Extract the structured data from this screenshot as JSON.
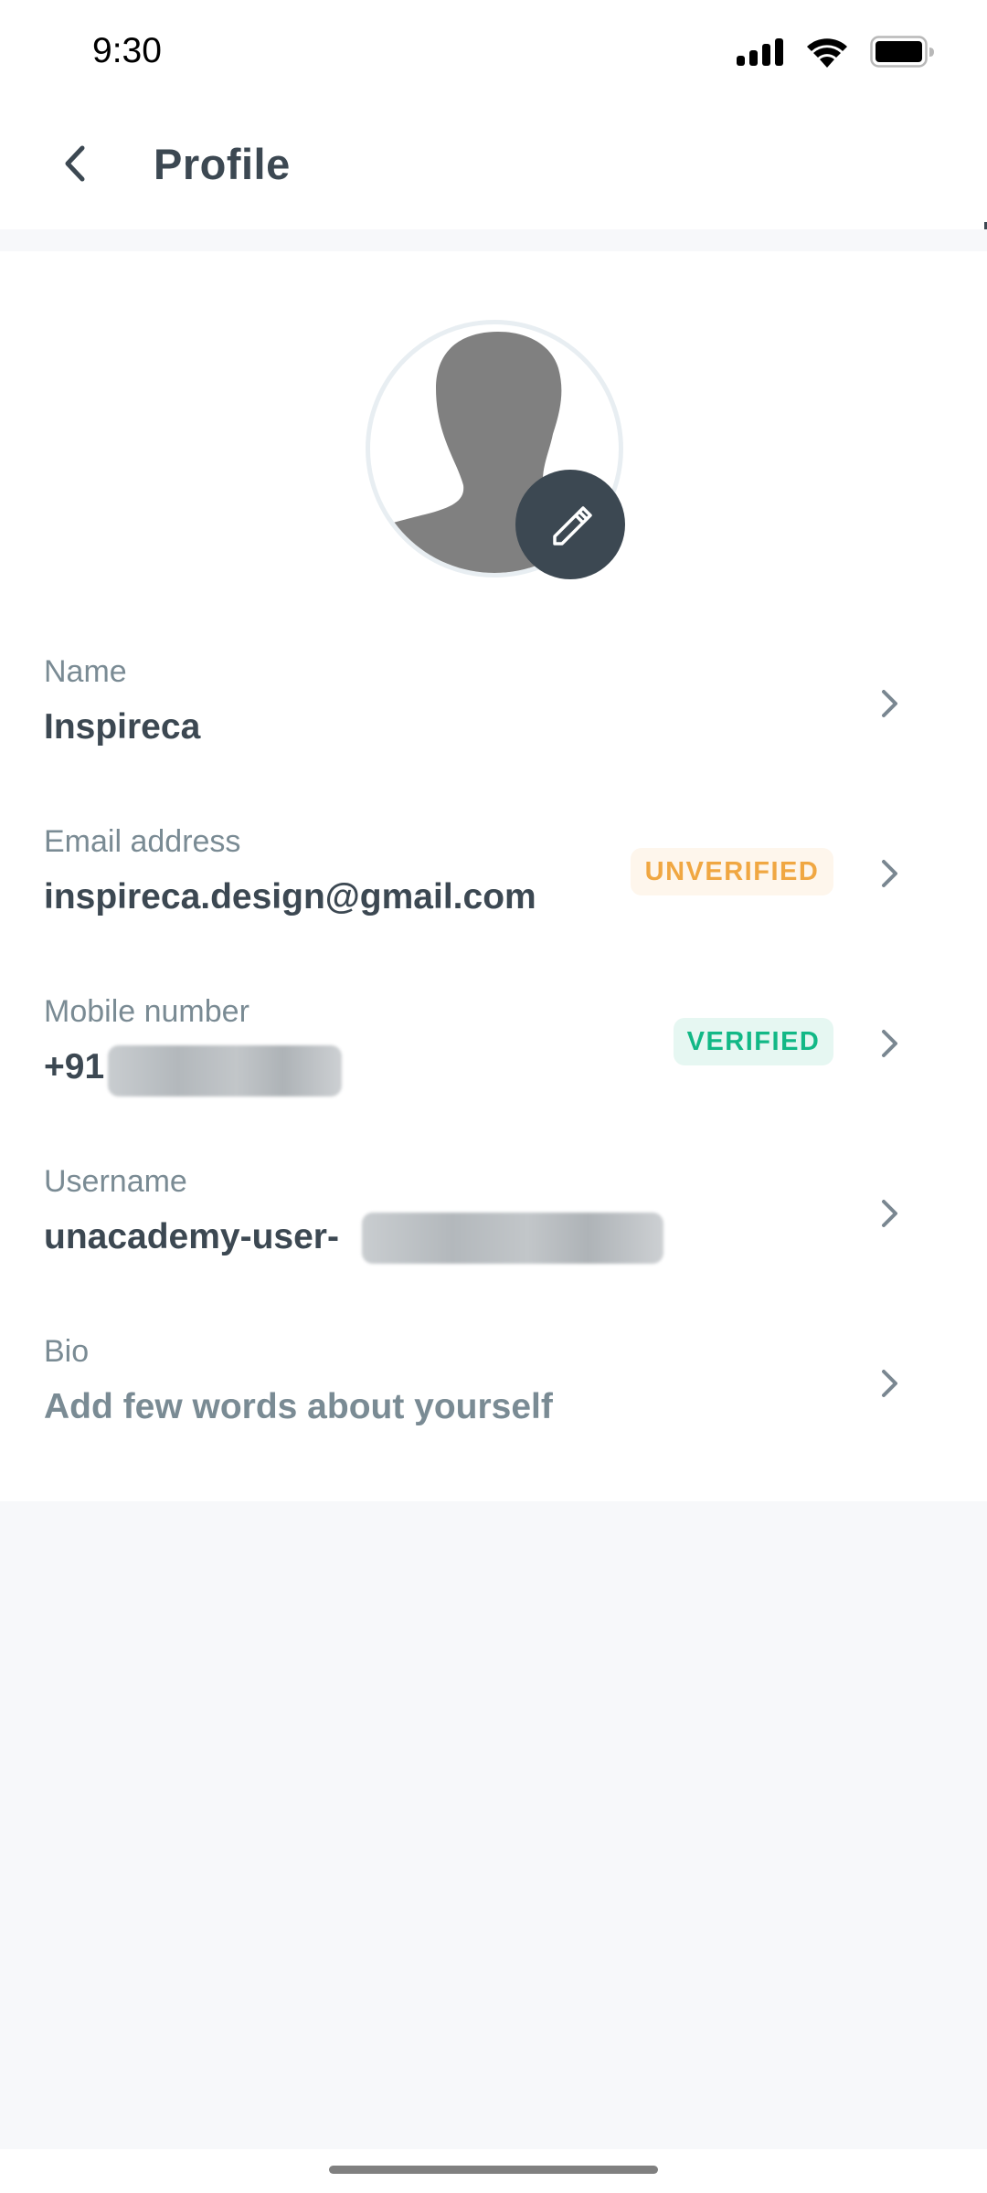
{
  "status_bar": {
    "time": "9:30",
    "icons": [
      "cellular-signal-icon",
      "wifi-icon",
      "battery-icon"
    ]
  },
  "header": {
    "back_icon": "chevron-left-icon",
    "title": "Profile"
  },
  "avatar": {
    "placeholder_icon": "user-silhouette-icon",
    "edit_icon": "pencil-icon"
  },
  "fields": [
    {
      "label": "Name",
      "value": "Inspireca",
      "badge": null,
      "redacted": false
    },
    {
      "label": "Email address",
      "value": "inspireca.design@gmail.com",
      "badge": "UNVERIFIED",
      "badge_color": "#F0A742",
      "redacted": false
    },
    {
      "label": "Mobile number",
      "value": "+91",
      "badge": "VERIFIED",
      "badge_color": "#12B886",
      "redacted": true
    },
    {
      "label": "Username",
      "value": "unacademy-user-",
      "badge": null,
      "redacted": true
    },
    {
      "label": "Bio",
      "value": "Add few words about yourself",
      "badge": null,
      "redacted": false,
      "is_placeholder": true
    }
  ],
  "colors": {
    "text_primary": "#3C4852",
    "text_secondary": "#7A8B94",
    "unverified": "#F0A742",
    "verified": "#12B886",
    "background_gray": "#F7F8FA"
  }
}
